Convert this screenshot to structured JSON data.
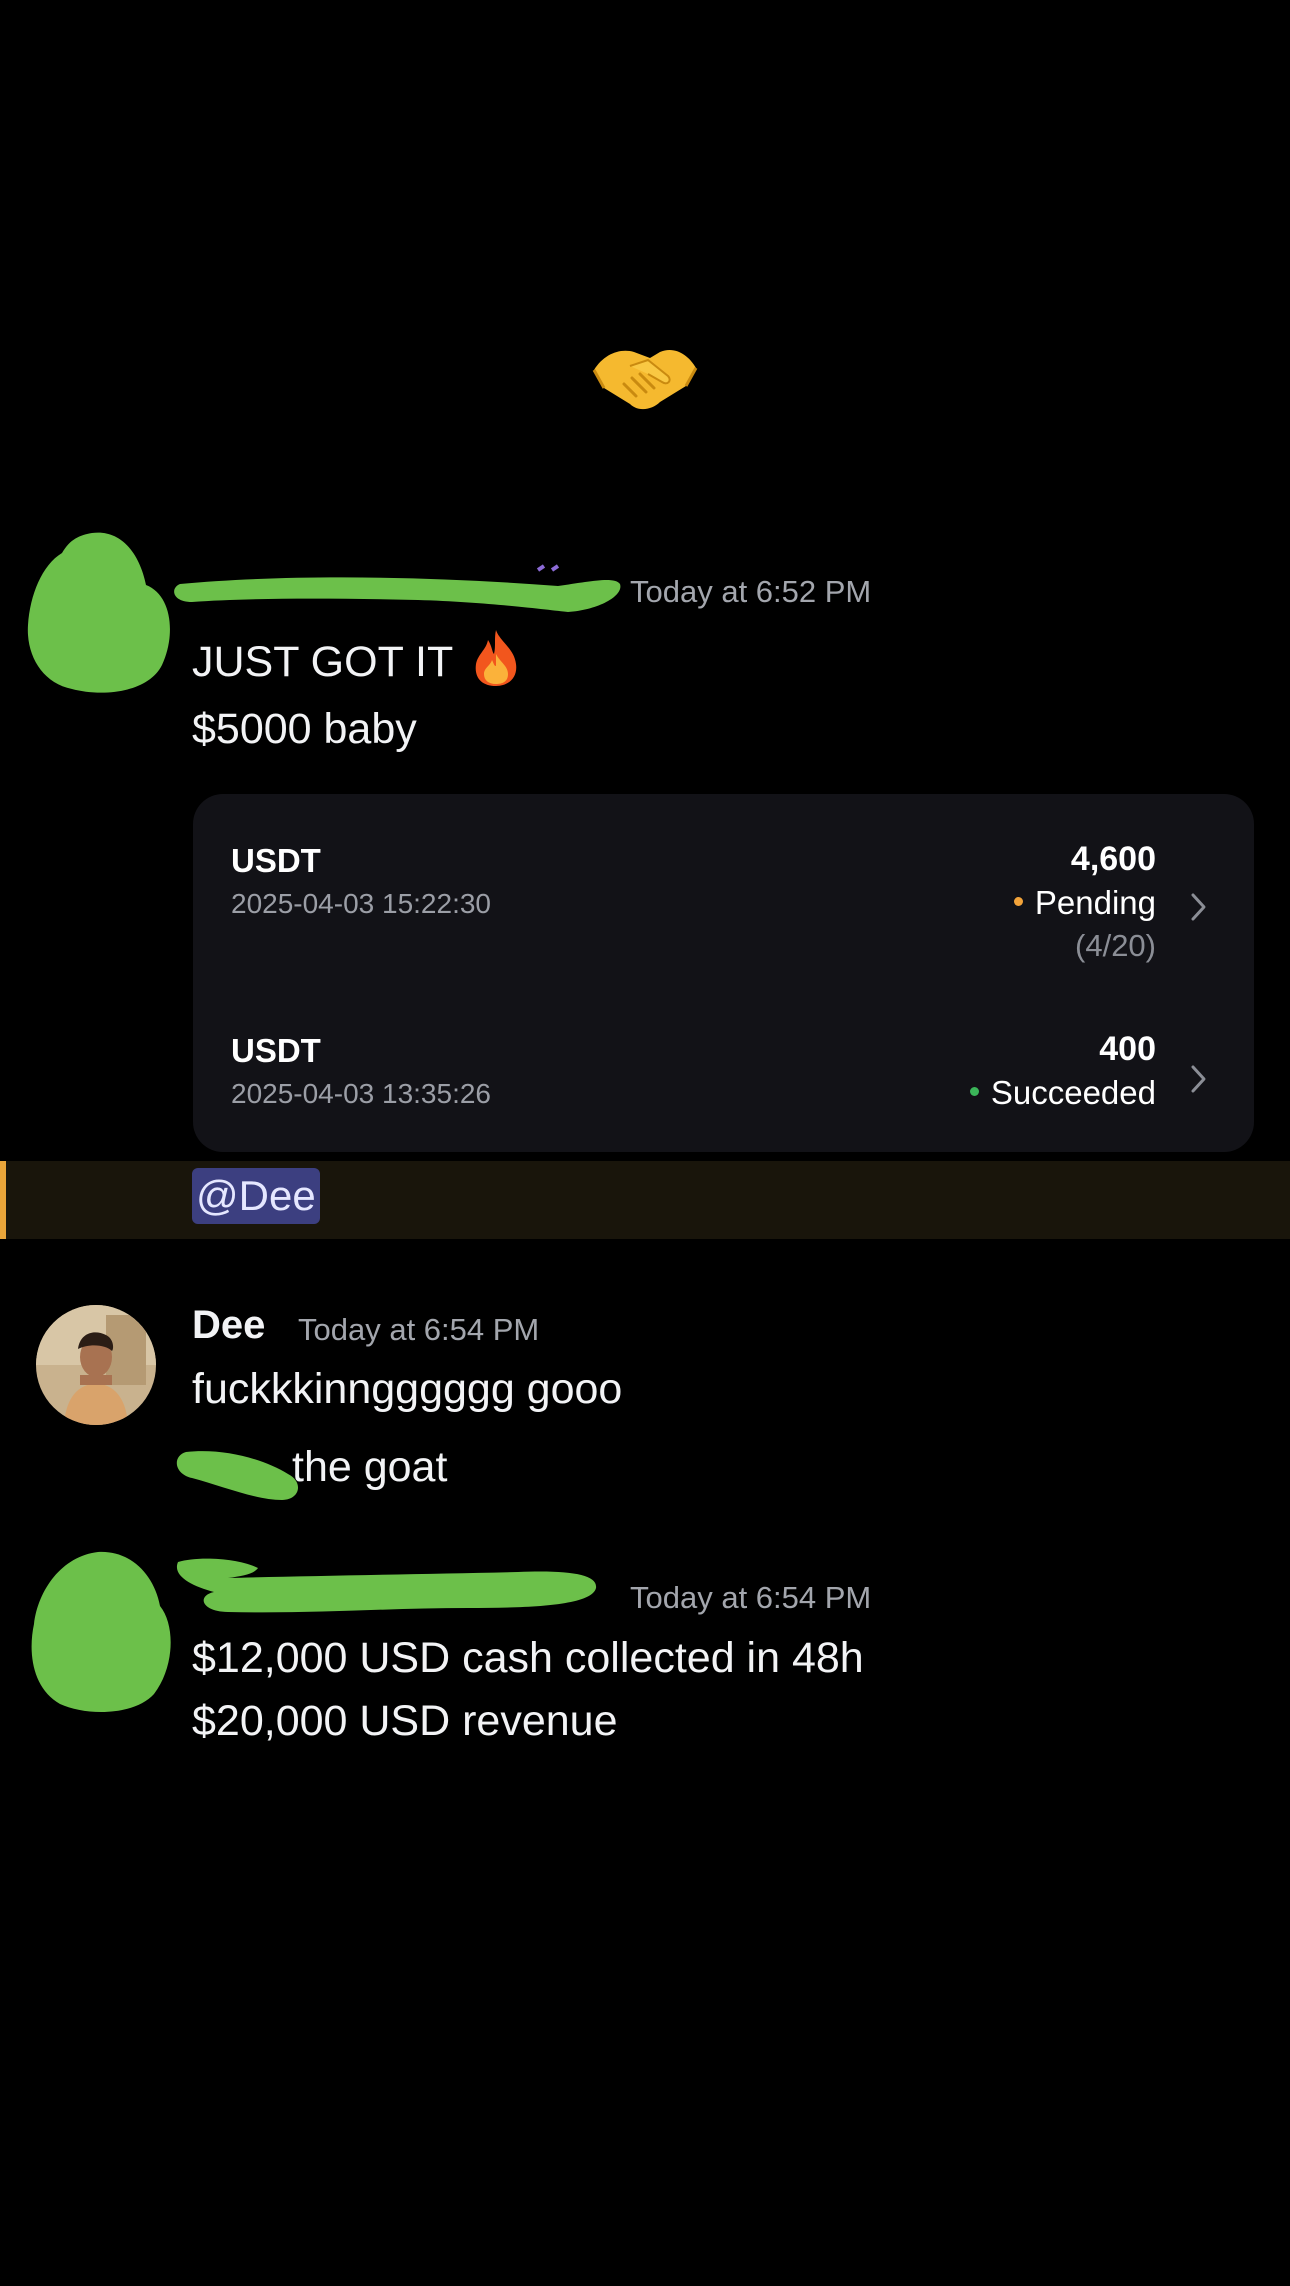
{
  "icons": {
    "handshake": "handshake-emoji",
    "fire": "fire-emoji",
    "chevron": "chevron-right-icon"
  },
  "colors": {
    "background": "#000000",
    "card": "#121217",
    "pending": "#f2a33a",
    "succeeded": "#3bb559",
    "mention_accent": "#e9a53a",
    "mention_pill": "#3c3f80",
    "redaction": "#6cc04a"
  },
  "messages": [
    {
      "timestamp": "Today at 6:52 PM",
      "lines": [
        "JUST GOT IT",
        "$5000 baby"
      ]
    },
    {
      "username": "Dee",
      "timestamp": "Today at 6:54 PM",
      "lines": [
        "fuckkkinngggggg gooo",
        "the goat"
      ]
    },
    {
      "timestamp": "Today at 6:54 PM",
      "lines": [
        "$12,000 USD cash collected in 48h",
        "$20,000 USD revenue"
      ]
    }
  ],
  "transactions": [
    {
      "coin": "USDT",
      "datetime": "2025-04-03 15:22:30",
      "amount": "4,600",
      "status": "Pending",
      "progress": "(4/20)"
    },
    {
      "coin": "USDT",
      "datetime": "2025-04-03 13:35:26",
      "amount": "400",
      "status": "Succeeded"
    }
  ],
  "mention": "@Dee"
}
